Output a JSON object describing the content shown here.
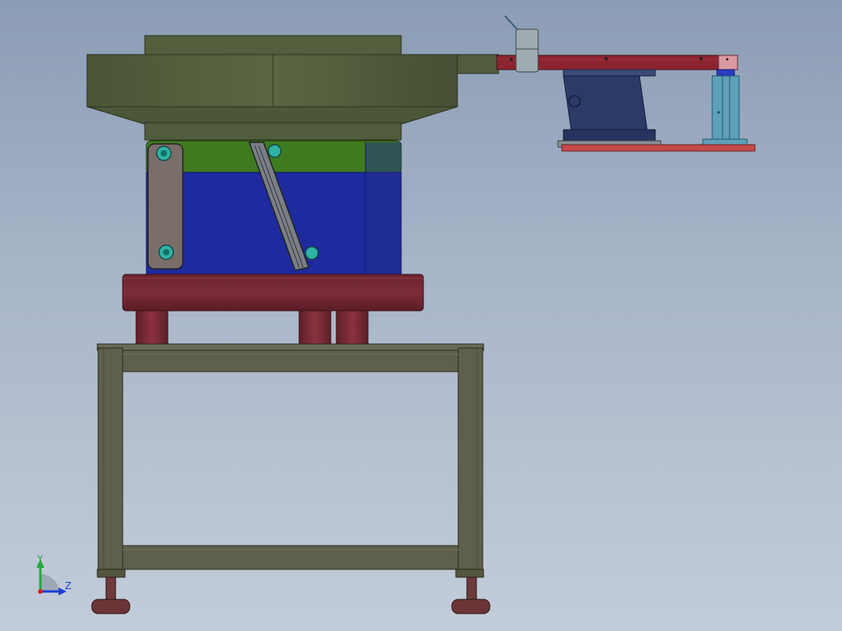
{
  "triad": {
    "y_label": "Y",
    "z_label": "Z",
    "colors": {
      "y": "#1faa3a",
      "z": "#1b3fd6",
      "x": "#d21f1f"
    }
  },
  "colors": {
    "bowl": "#515c3c",
    "drive_green": "#3e7a1f",
    "drive_blue": "#1e2a9e",
    "base_ring": "#732631",
    "frame": "#5e5f4c",
    "rail": "#8c2430",
    "hopper_base": "#2c3a68",
    "sensor_stand": "#5da0b8"
  }
}
